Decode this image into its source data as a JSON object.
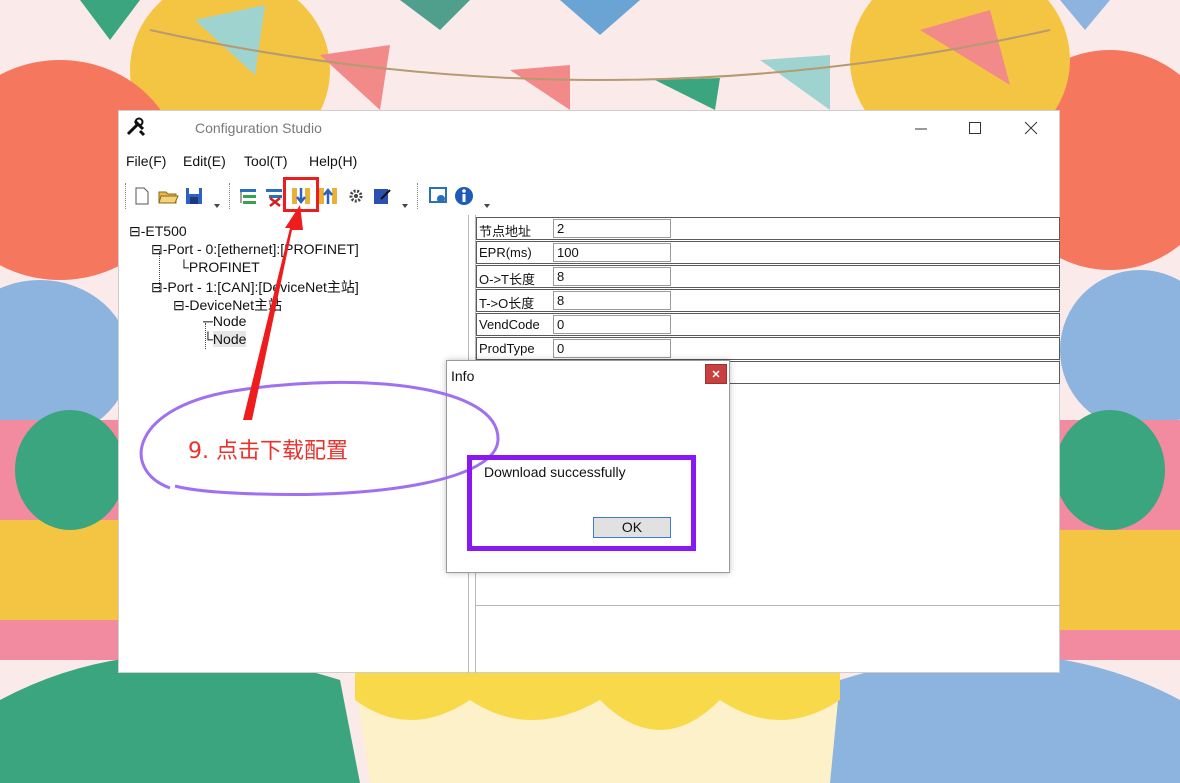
{
  "window": {
    "title": "Configuration Studio",
    "minimize": "minimize",
    "maximize": "maximize",
    "close": "close"
  },
  "menu": [
    {
      "label": "File(F)"
    },
    {
      "label": "Edit(E)"
    },
    {
      "label": "Tool(T)"
    },
    {
      "label": "Help(H)"
    }
  ],
  "toolbar": {
    "icons": [
      "new-file-icon",
      "open-folder-icon",
      "save-icon",
      "add-device-icon",
      "delete-device-icon",
      "download-config-icon",
      "upload-config-icon",
      "settings-gear-icon",
      "edit-icon",
      "monitor-icon",
      "info-icon"
    ]
  },
  "tree": {
    "root": "ET500",
    "port0": "Port - 0:[ethernet]:[PROFINET]",
    "port0_child": "PROFINET",
    "port1": "Port - 1:[CAN]:[DeviceNet主站]",
    "port1_child": "DeviceNet主站",
    "node1": "Node",
    "node2": "Node"
  },
  "properties": [
    {
      "label": "节点地址",
      "value": "2"
    },
    {
      "label": "EPR(ms)",
      "value": "100"
    },
    {
      "label": "O->T长度",
      "value": "8"
    },
    {
      "label": "T->O长度",
      "value": "8"
    },
    {
      "label": "VendCode",
      "value": "0"
    },
    {
      "label": "ProdType",
      "value": "0"
    },
    {
      "label": "",
      "value": ""
    }
  ],
  "dialog": {
    "title": "Info",
    "message": "Download successfully",
    "ok_label": "OK"
  },
  "annotation": {
    "step_text": "9. 点击下载配置"
  },
  "colors": {
    "highlight_red": "#ee1c1c",
    "highlight_purple": "#8b18f0",
    "annotation_text": "#e8322c",
    "close_button": "#c94040"
  }
}
